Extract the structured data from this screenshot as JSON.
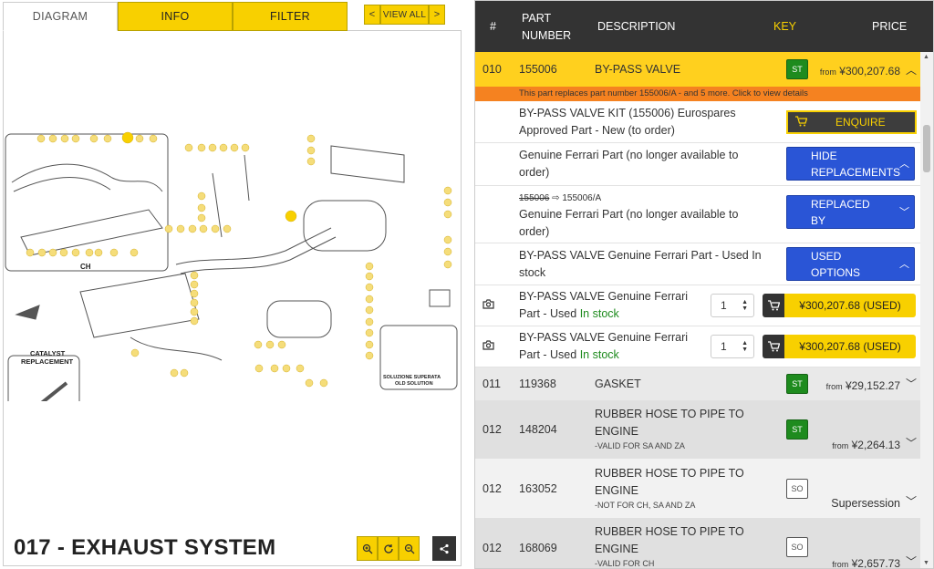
{
  "tabs": {
    "diagram": "DIAGRAM",
    "info": "INFO",
    "filter": "FILTER"
  },
  "nav": {
    "prev": "<",
    "view_all": "VIEW ALL",
    "next": ">"
  },
  "diagram": {
    "title": "017 - EXHAUST SYSTEM",
    "labels": {
      "ch": "CH",
      "catalyst": "CATALYST",
      "replacement": "REPLACEMENT",
      "old1": "SOLUZIONE SUPERATA",
      "old2": "OLD SOLUTION"
    }
  },
  "table": {
    "headers": {
      "num": "#",
      "part1": "PART",
      "part2": "NUMBER",
      "description": "DESCRIPTION",
      "key": "KEY",
      "price": "PRICE"
    },
    "main": {
      "num": "010",
      "part": "155006",
      "desc": "BY-PASS VALVE",
      "key": "ST",
      "price_from": "from",
      "price": "¥300,207.68"
    },
    "replace_notice": "This part replaces part number 155006/A - and 5 more. Click to view details",
    "subs": [
      {
        "line1": "BY-PASS VALVE KIT (155006) Eurospares",
        "line2": "Approved Part - New (to order)",
        "button": "ENQUIRE"
      },
      {
        "line1": "Genuine Ferrari Part (no longer available to",
        "line2": "order)",
        "button1": "HIDE",
        "button2": "REPLACEMENTS"
      },
      {
        "old": "155006",
        "new": "155006/A",
        "line1": "Genuine Ferrari Part (no longer available to",
        "line2": "order)",
        "button1": "REPLACED",
        "button2": "BY"
      },
      {
        "line1": "BY-PASS VALVE Genuine Ferrari Part - Used In",
        "line2": "stock",
        "button1": "USED",
        "button2": "OPTIONS"
      },
      {
        "line1": "BY-PASS VALVE Genuine Ferrari",
        "line2a": "Part - Used",
        "line2b": "In stock",
        "qty": "1",
        "price": "¥300,207.68 (USED)"
      },
      {
        "line1": "BY-PASS VALVE Genuine Ferrari",
        "line2a": "Part - Used",
        "line2b": "In stock",
        "qty": "1",
        "price": "¥300,207.68 (USED)"
      }
    ],
    "rows": [
      {
        "num": "011",
        "part": "119368",
        "desc": "GASKET",
        "key": "ST",
        "price_from": "from",
        "price": "¥29,152.27"
      },
      {
        "num": "012",
        "part": "148204",
        "desc1": "RUBBER HOSE TO PIPE TO",
        "desc2": "ENGINE",
        "note": "-VALID FOR SA AND ZA",
        "key": "ST",
        "price_from": "from",
        "price": "¥2,264.13"
      },
      {
        "num": "012",
        "part": "163052",
        "desc1": "RUBBER HOSE TO PIPE TO",
        "desc2": "ENGINE",
        "note": "-NOT FOR CH, SA AND ZA",
        "key": "SO",
        "price": "Supersession"
      },
      {
        "num": "012",
        "part": "168069",
        "desc1": "RUBBER HOSE TO PIPE TO",
        "desc2": "ENGINE",
        "note": "-VALID FOR CH",
        "key": "SO",
        "price_from": "from",
        "price": "¥2,657.73"
      }
    ]
  },
  "colors": {
    "accent": "#f8d000",
    "header": "#333333",
    "orange": "#f58220",
    "blue": "#2a55d6",
    "green": "#1e8b1e",
    "row_alt": "#e9e9e9",
    "highlight": "#ffd01e"
  }
}
